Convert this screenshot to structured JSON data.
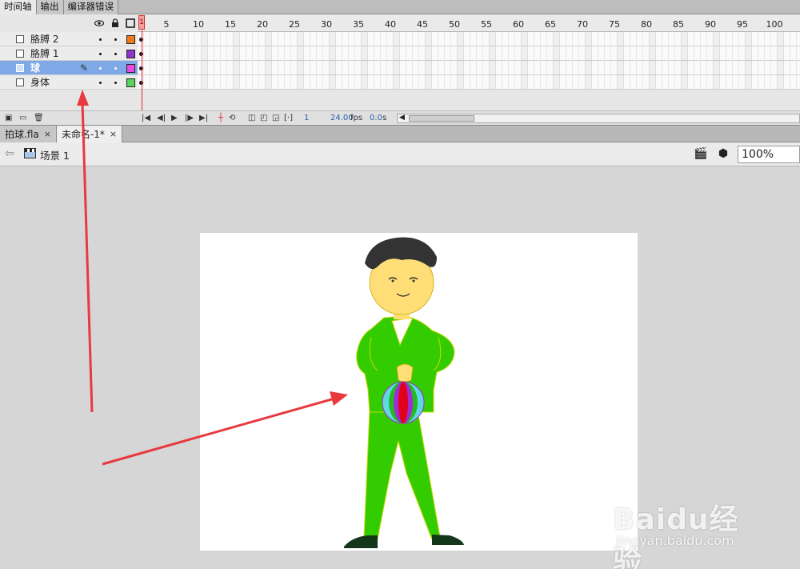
{
  "panel_tabs": [
    "时间轴",
    "输出",
    "编译器错误"
  ],
  "layers": [
    {
      "name": "胳膊 2",
      "color": "#f07a1a",
      "selected": false,
      "editing": false
    },
    {
      "name": "胳膊 1",
      "color": "#8e35c6",
      "selected": false,
      "editing": false
    },
    {
      "name": "球",
      "color": "#e84be0",
      "selected": true,
      "editing": true
    },
    {
      "name": "身体",
      "color": "#5ad45a",
      "selected": false,
      "editing": false
    }
  ],
  "header_icons": {
    "eye": "eye-icon",
    "lock": "lock-icon",
    "outline": "outline-icon"
  },
  "ruler": {
    "labels": [
      "1",
      "5",
      "10",
      "15",
      "20",
      "25",
      "30",
      "35",
      "40",
      "45",
      "50",
      "55",
      "60",
      "65",
      "70",
      "75",
      "80",
      "85",
      "90",
      "95",
      "100"
    ],
    "playhead_label": "1"
  },
  "timeline_toolbar": {
    "current_frame": "1",
    "fps": "24.00",
    "fps_unit": "fps",
    "time": "0.0",
    "time_unit": "s"
  },
  "doc_tabs": [
    {
      "label": "拍球.fla",
      "active": false
    },
    {
      "label": "未命名-1*",
      "active": true
    }
  ],
  "scene": {
    "label": "场景 1"
  },
  "zoom": "100%",
  "watermark": {
    "brand": "Baidu经验",
    "url": "jingyan.baidu.com"
  },
  "colors": {
    "suit": "#33cc00",
    "skin": "#ffdd77",
    "hair": "#333333",
    "ball_red": "#e0001a",
    "ball_green": "#22bb22",
    "ball_cyan": "#5fd9e0",
    "ball_purple": "#a22bd8",
    "arrow": "#e8393f"
  }
}
